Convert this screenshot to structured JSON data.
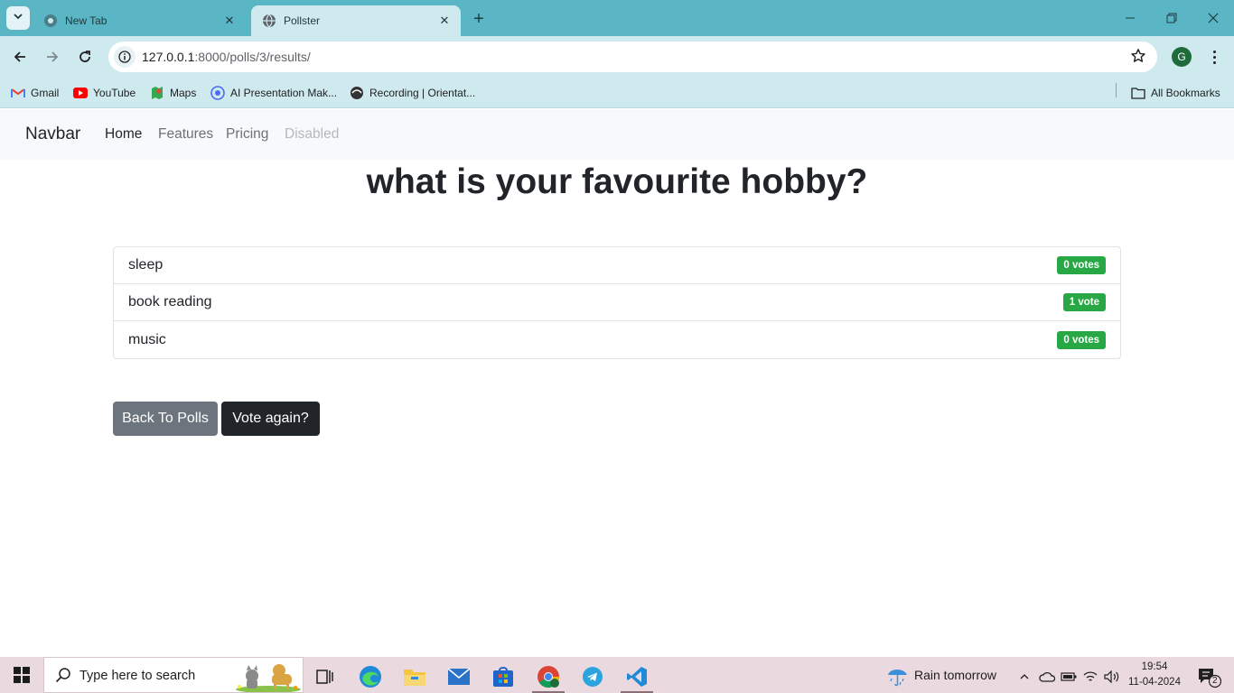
{
  "browser": {
    "tabs": [
      {
        "title": "New Tab",
        "active": false
      },
      {
        "title": "Pollster",
        "active": true
      }
    ],
    "url_host": "127.0.0.1",
    "url_path": ":8000/polls/3/results/",
    "profile_initial": "G",
    "bookmarks": [
      {
        "label": "Gmail",
        "icon": "gmail-icon"
      },
      {
        "label": "YouTube",
        "icon": "youtube-icon"
      },
      {
        "label": "Maps",
        "icon": "maps-icon"
      },
      {
        "label": "AI Presentation Mak...",
        "icon": "ai-presentation-icon"
      },
      {
        "label": "Recording | Orientat...",
        "icon": "recording-icon"
      }
    ],
    "all_bookmarks_label": "All Bookmarks"
  },
  "navbar": {
    "brand": "Navbar",
    "links": {
      "home": "Home",
      "features": "Features",
      "pricing": "Pricing",
      "disabled": "Disabled"
    }
  },
  "poll": {
    "question": "what is your favourite hobby?",
    "choices": [
      {
        "text": "sleep",
        "votes": "0 votes"
      },
      {
        "text": "book reading",
        "votes": "1 vote"
      },
      {
        "text": "music",
        "votes": "0 votes"
      }
    ],
    "back_button": "Back To Polls",
    "vote_again_button": "Vote again?"
  },
  "taskbar": {
    "search_placeholder": "Type here to search",
    "weather": "Rain tomorrow",
    "time": "19:54",
    "date": "11-04-2024",
    "notification_count": "2"
  },
  "colors": {
    "tabstrip": "#5ab5c4",
    "toolbar": "#cfeaee",
    "badge_success": "#28a745",
    "btn_secondary": "#6c757d",
    "btn_dark": "#212529",
    "taskbar": "#ead9df"
  }
}
